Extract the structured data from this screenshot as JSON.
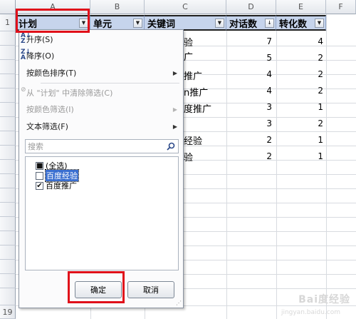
{
  "columns": [
    "A",
    "B",
    "C",
    "D",
    "E",
    "F"
  ],
  "rows": [
    "1",
    "19"
  ],
  "header_row": {
    "plan": "计划",
    "unit": "单元",
    "keyword": "关键词",
    "dialogs": "对话数",
    "conversions": "转化数"
  },
  "data": {
    "dialogs": [
      "7",
      "5",
      "4",
      "4",
      "3",
      "3",
      "2",
      "2"
    ],
    "conversions": [
      "4",
      "2",
      "2",
      "2",
      "1",
      "2",
      "1",
      "1"
    ],
    "keyword_fragments": [
      "验",
      "广",
      "推广",
      "n推广",
      "度推广",
      "",
      "经验",
      "验"
    ]
  },
  "menu": {
    "sort_asc": "升序(S)",
    "sort_desc": "降序(O)",
    "sort_by_color": "按颜色排序(T)",
    "clear_filter": "从 \"计划\" 中清除筛选(C)",
    "filter_by_color": "按颜色筛选(I)",
    "text_filter": "文本筛选(F)",
    "search_placeholder": "搜索",
    "select_all": "(全选)",
    "option_1": "百度经验",
    "option_2": "百度推广",
    "ok": "确定",
    "cancel": "取消"
  },
  "checks": {
    "select_all": "■",
    "option_1": "",
    "option_2": "✔"
  },
  "watermark": {
    "main": "Bai度经验",
    "sub": "jingyan.baidu.com"
  },
  "colors": {
    "header_fill": "#c6d4ec",
    "highlight": "#e0101a",
    "selection": "#3a6fd0"
  }
}
